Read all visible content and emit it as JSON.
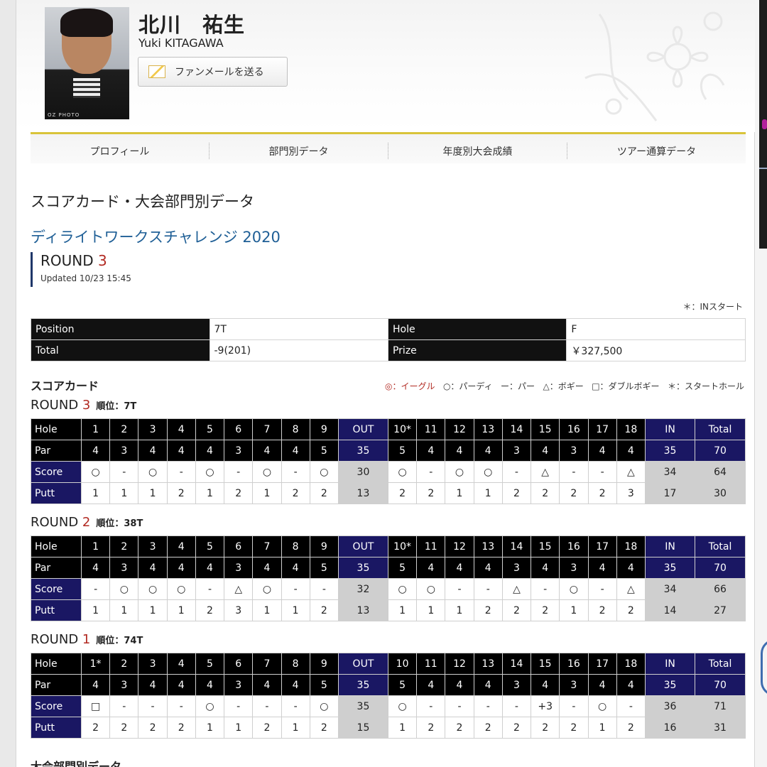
{
  "player": {
    "name_ja": "北川　祐生",
    "name_en": "Yuki KITAGAWA",
    "photo_caption": "OZ PHOTO",
    "fanmail_label": "ファンメールを送る"
  },
  "tabs": [
    "プロフィール",
    "部門別データ",
    "年度別大会成績",
    "ツアー通算データ"
  ],
  "section_title": "スコアカード・大会部門別データ",
  "tournament": "ディライトワークスチャレンジ 2020",
  "round": {
    "label": "ROUND",
    "number": "3",
    "updated": "Updated 10/23 15:45"
  },
  "note": "＊：INスタート",
  "summary": {
    "position_label": "Position",
    "position": "7T",
    "hole_label": "Hole",
    "hole": "F",
    "total_label": "Total",
    "total": "-9(201)",
    "prize_label": "Prize",
    "prize": "￥327,500"
  },
  "scorecard_title": "スコアカード",
  "legend": {
    "eagle": "◎：イーグル",
    "birdie": "○：パーディ",
    "par": "ー：パー",
    "bogey": "△：ボギー",
    "double": "□：ダブルボギー",
    "start": "＊：スタートホール"
  },
  "row_labels": {
    "hole": "Hole",
    "par": "Par",
    "score": "Score",
    "putt": "Putt"
  },
  "rounds": [
    {
      "label": "ROUND",
      "number": "3",
      "rank_label": "順位：7T",
      "holes": [
        "1",
        "2",
        "3",
        "4",
        "5",
        "6",
        "7",
        "8",
        "9",
        "OUT",
        "10*",
        "11",
        "12",
        "13",
        "14",
        "15",
        "16",
        "17",
        "18",
        "IN",
        "Total"
      ],
      "par": [
        "4",
        "3",
        "4",
        "4",
        "4",
        "3",
        "4",
        "4",
        "5",
        "35",
        "5",
        "4",
        "4",
        "4",
        "3",
        "4",
        "3",
        "4",
        "4",
        "35",
        "70"
      ],
      "score": [
        "○",
        "-",
        "○",
        "-",
        "○",
        "-",
        "○",
        "-",
        "○",
        "30",
        "○",
        "-",
        "○",
        "○",
        "-",
        "△",
        "-",
        "-",
        "△",
        "34",
        "64"
      ],
      "putt": [
        "1",
        "1",
        "1",
        "2",
        "1",
        "2",
        "1",
        "2",
        "2",
        "13",
        "2",
        "2",
        "1",
        "1",
        "2",
        "2",
        "2",
        "2",
        "3",
        "17",
        "30"
      ]
    },
    {
      "label": "ROUND",
      "number": "2",
      "rank_label": "順位：38T",
      "holes": [
        "1",
        "2",
        "3",
        "4",
        "5",
        "6",
        "7",
        "8",
        "9",
        "OUT",
        "10*",
        "11",
        "12",
        "13",
        "14",
        "15",
        "16",
        "17",
        "18",
        "IN",
        "Total"
      ],
      "par": [
        "4",
        "3",
        "4",
        "4",
        "4",
        "3",
        "4",
        "4",
        "5",
        "35",
        "5",
        "4",
        "4",
        "4",
        "3",
        "4",
        "3",
        "4",
        "4",
        "35",
        "70"
      ],
      "score": [
        "-",
        "○",
        "○",
        "○",
        "-",
        "△",
        "○",
        "-",
        "-",
        "32",
        "○",
        "○",
        "-",
        "-",
        "△",
        "-",
        "○",
        "-",
        "△",
        "34",
        "66"
      ],
      "putt": [
        "1",
        "1",
        "1",
        "1",
        "2",
        "3",
        "1",
        "1",
        "2",
        "13",
        "1",
        "1",
        "1",
        "2",
        "2",
        "2",
        "1",
        "2",
        "2",
        "14",
        "27"
      ]
    },
    {
      "label": "ROUND",
      "number": "1",
      "rank_label": "順位：74T",
      "holes": [
        "1*",
        "2",
        "3",
        "4",
        "5",
        "6",
        "7",
        "8",
        "9",
        "OUT",
        "10",
        "11",
        "12",
        "13",
        "14",
        "15",
        "16",
        "17",
        "18",
        "IN",
        "Total"
      ],
      "par": [
        "4",
        "3",
        "4",
        "4",
        "4",
        "3",
        "4",
        "4",
        "5",
        "35",
        "5",
        "4",
        "4",
        "4",
        "3",
        "4",
        "3",
        "4",
        "4",
        "35",
        "70"
      ],
      "score": [
        "□",
        "-",
        "-",
        "-",
        "○",
        "-",
        "-",
        "-",
        "○",
        "35",
        "○",
        "-",
        "-",
        "-",
        "-",
        "+3",
        "-",
        "○",
        "-",
        "36",
        "71"
      ],
      "putt": [
        "2",
        "2",
        "2",
        "2",
        "1",
        "1",
        "2",
        "1",
        "2",
        "15",
        "1",
        "2",
        "2",
        "2",
        "2",
        "2",
        "2",
        "1",
        "2",
        "16",
        "31"
      ]
    }
  ],
  "bottom_title": "大会部門別データ"
}
